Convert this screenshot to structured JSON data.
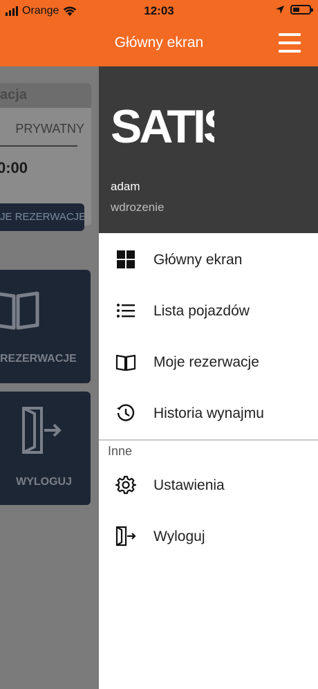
{
  "status_bar": {
    "carrier": "Orange",
    "time": "12:03"
  },
  "header": {
    "title": "Główny ekran"
  },
  "background": {
    "card_header": "acja",
    "type_label": "PRYWATNY",
    "time_value": "0:00",
    "button_label": "JE REZERWACJE",
    "tiles": [
      {
        "label": "REZERWACJE",
        "icon": "book-icon"
      },
      {
        "label": "WYLOGUJ",
        "icon": "logout-icon"
      }
    ]
  },
  "drawer": {
    "logo_text": "SATIS",
    "user": {
      "name": "adam",
      "subtitle": "wdrozenie"
    },
    "items": [
      {
        "label": "Główny ekran",
        "icon": "grid-icon"
      },
      {
        "label": "Lista pojazdów",
        "icon": "list-icon"
      },
      {
        "label": "Moje rezerwacje",
        "icon": "book-icon"
      },
      {
        "label": "Historia wynajmu",
        "icon": "history-icon"
      }
    ],
    "section_label": "Inne",
    "other_items": [
      {
        "label": "Ustawienia",
        "icon": "gear-icon"
      },
      {
        "label": "Wyloguj",
        "icon": "logout-icon"
      }
    ]
  },
  "colors": {
    "brand_orange": "#f36a23",
    "drawer_header": "#3b3b3b",
    "tile_dark": "#1c2635"
  }
}
